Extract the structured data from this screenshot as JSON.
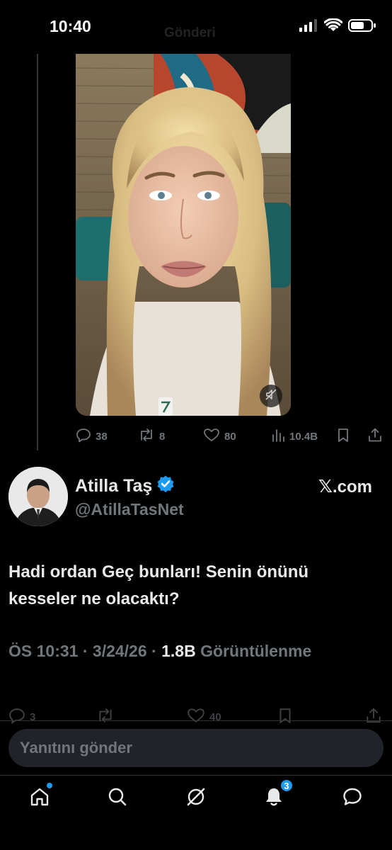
{
  "status_bar": {
    "time": "10:40",
    "ghost_title": "Gönderi"
  },
  "media_actions": {
    "replies": "38",
    "reposts": "8",
    "likes": "80",
    "views": "10.4B"
  },
  "author": {
    "name": "Atilla Taş",
    "handle": "@AtillaTasNet",
    "source_mark": "𝕏",
    "source_domain": ".com",
    "verified": true
  },
  "tweet": {
    "line1": "Hadi ordan Geç bunları! Senin önünü",
    "line2": "kesseler ne olacaktı?",
    "time": "ÖS 10:31",
    "date": "3/24/26",
    "views_count": "1.8B",
    "views_label": "Görüntülenme"
  },
  "bottom_actions": {
    "replies": "3",
    "likes": "40"
  },
  "reply": {
    "placeholder": "Yanıtını gönder"
  },
  "tabbar": {
    "notifications_badge": "3"
  },
  "colors": {
    "accent": "#1d9bf0",
    "background": "#000000",
    "muted": "#71767b",
    "text": "#e7e9ea"
  },
  "icons": [
    "cellular-signal-icon",
    "wifi-icon",
    "battery-icon",
    "mute-icon",
    "reply-icon",
    "repost-icon",
    "like-icon",
    "views-icon",
    "bookmark-icon",
    "share-icon",
    "verified-badge-icon",
    "home-icon",
    "search-icon",
    "grok-icon",
    "notifications-icon",
    "messages-icon"
  ]
}
